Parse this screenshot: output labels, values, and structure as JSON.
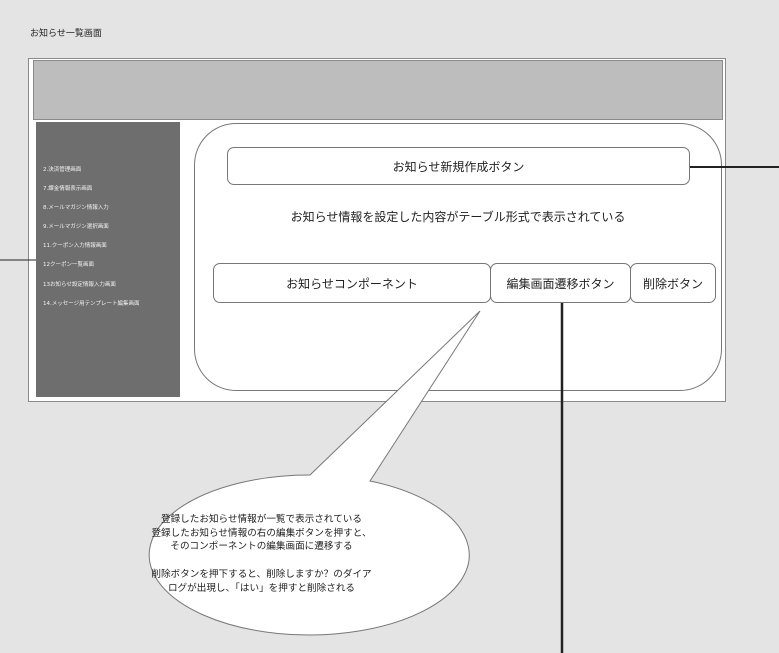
{
  "page_title": "お知らせ一覧画面",
  "sidebar": {
    "items": [
      "2.決済管理画面",
      "7.課金情報表示画面",
      "8.メールマガジン情報入力",
      "9.メールマガジン選択画面",
      "11.クーポン入力情報画面",
      "12クーポン一覧画面",
      "13お知らせ設定情報入力画面",
      "14.メッセージ用テンプレート編集画面"
    ]
  },
  "main": {
    "create_button": "お知らせ新規作成ボタン",
    "description": "お知らせ情報を設定した内容がテーブル形式で表示されている",
    "component_label": "お知らせコンポーネント",
    "edit_button": "編集画面遷移ボタン",
    "delete_button": "削除ボタン"
  },
  "callout": {
    "lines": [
      "登録したお知らせ情報が一覧で表示されている",
      "登録したお知らせ情報の右の編集ボタンを押すと、",
      "そのコンポーネントの編集画面に遷移する",
      "",
      "削除ボタンを押下すると、削除しますか？のダイア",
      "ログが出現し、「はい」を押すと削除される"
    ]
  }
}
